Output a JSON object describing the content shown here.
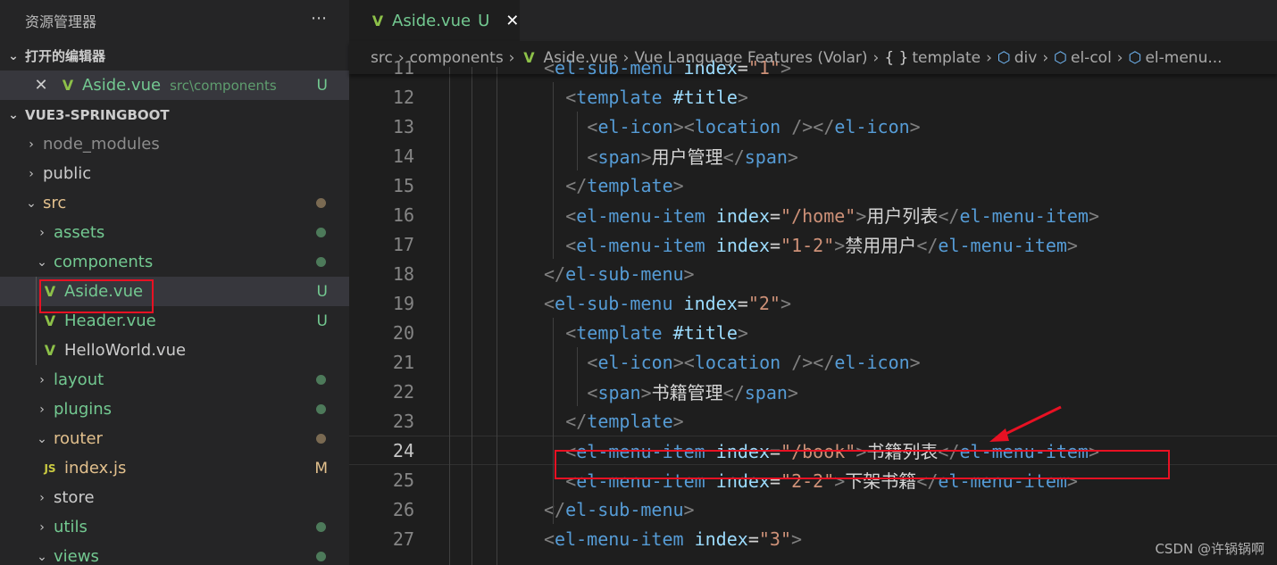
{
  "sidebar": {
    "title": "资源管理器",
    "more_icon": "⋯",
    "open_editors_label": "打开的编辑器",
    "open_editor": {
      "name": "Aside.vue",
      "path": "src\\components",
      "status": "U"
    },
    "project_label": "VUE3-SPRINGBOOT",
    "tree": [
      {
        "name": "node_modules",
        "type": "folder",
        "expanded": false
      },
      {
        "name": "public",
        "type": "folder",
        "expanded": false
      },
      {
        "name": "src",
        "type": "folder",
        "expanded": true
      },
      {
        "name": "assets",
        "type": "folder",
        "expanded": false
      },
      {
        "name": "components",
        "type": "folder",
        "expanded": true
      },
      {
        "name": "Aside.vue",
        "type": "vue",
        "status": "U"
      },
      {
        "name": "Header.vue",
        "type": "vue",
        "status": "U"
      },
      {
        "name": "HelloWorld.vue",
        "type": "vue"
      },
      {
        "name": "layout",
        "type": "folder",
        "expanded": false
      },
      {
        "name": "plugins",
        "type": "folder",
        "expanded": false
      },
      {
        "name": "router",
        "type": "folder",
        "expanded": true
      },
      {
        "name": "index.js",
        "type": "js",
        "status": "M"
      },
      {
        "name": "store",
        "type": "folder",
        "expanded": false
      },
      {
        "name": "utils",
        "type": "folder",
        "expanded": false
      },
      {
        "name": "views",
        "type": "folder",
        "expanded": true
      }
    ]
  },
  "editor": {
    "tab": {
      "name": "Aside.vue",
      "status": "U",
      "close": "✕"
    },
    "breadcrumb": [
      "src",
      "components",
      "Aside.vue",
      "Vue Language Features (Volar)",
      "template",
      "div",
      "el-col",
      "el-menu..."
    ],
    "lines": [
      {
        "n": "11",
        "indent": 0,
        "tokens": [
          [
            "br",
            "<"
          ],
          [
            "tag",
            "el-sub-menu"
          ],
          [
            "plain",
            " "
          ],
          [
            "attr",
            "index"
          ],
          [
            "plain",
            "="
          ],
          [
            "str",
            "\"1\""
          ],
          [
            "br",
            ">"
          ]
        ]
      },
      {
        "n": "12",
        "indent": 1,
        "tokens": [
          [
            "br",
            "<"
          ],
          [
            "tag",
            "template"
          ],
          [
            "plain",
            " "
          ],
          [
            "attr",
            "#title"
          ],
          [
            "br",
            ">"
          ]
        ]
      },
      {
        "n": "13",
        "indent": 2,
        "tokens": [
          [
            "br",
            "<"
          ],
          [
            "tag",
            "el-icon"
          ],
          [
            "br",
            "><"
          ],
          [
            "tag",
            "location"
          ],
          [
            "plain",
            " "
          ],
          [
            "br",
            "/></"
          ],
          [
            "tag",
            "el-icon"
          ],
          [
            "br",
            ">"
          ]
        ]
      },
      {
        "n": "14",
        "indent": 2,
        "tokens": [
          [
            "br",
            "<"
          ],
          [
            "tag",
            "span"
          ],
          [
            "br",
            ">"
          ],
          [
            "plain",
            "用户管理"
          ],
          [
            "br",
            "</"
          ],
          [
            "tag",
            "span"
          ],
          [
            "br",
            ">"
          ]
        ]
      },
      {
        "n": "15",
        "indent": 1,
        "tokens": [
          [
            "br",
            "</"
          ],
          [
            "tag",
            "template"
          ],
          [
            "br",
            ">"
          ]
        ]
      },
      {
        "n": "16",
        "indent": 1,
        "tokens": [
          [
            "br",
            "<"
          ],
          [
            "tag",
            "el-menu-item"
          ],
          [
            "plain",
            " "
          ],
          [
            "attr",
            "index"
          ],
          [
            "plain",
            "="
          ],
          [
            "str",
            "\"/home\""
          ],
          [
            "br",
            ">"
          ],
          [
            "plain",
            "用户列表"
          ],
          [
            "br",
            "</"
          ],
          [
            "tag",
            "el-menu-item"
          ],
          [
            "br",
            ">"
          ]
        ]
      },
      {
        "n": "17",
        "indent": 1,
        "tokens": [
          [
            "br",
            "<"
          ],
          [
            "tag",
            "el-menu-item"
          ],
          [
            "plain",
            " "
          ],
          [
            "attr",
            "index"
          ],
          [
            "plain",
            "="
          ],
          [
            "str",
            "\"1-2\""
          ],
          [
            "br",
            ">"
          ],
          [
            "plain",
            "禁用用户"
          ],
          [
            "br",
            "</"
          ],
          [
            "tag",
            "el-menu-item"
          ],
          [
            "br",
            ">"
          ]
        ]
      },
      {
        "n": "18",
        "indent": 0,
        "tokens": [
          [
            "br",
            "</"
          ],
          [
            "tag",
            "el-sub-menu"
          ],
          [
            "br",
            ">"
          ]
        ]
      },
      {
        "n": "19",
        "indent": 0,
        "tokens": [
          [
            "br",
            "<"
          ],
          [
            "tag",
            "el-sub-menu"
          ],
          [
            "plain",
            " "
          ],
          [
            "attr",
            "index"
          ],
          [
            "plain",
            "="
          ],
          [
            "str",
            "\"2\""
          ],
          [
            "br",
            ">"
          ]
        ]
      },
      {
        "n": "20",
        "indent": 1,
        "tokens": [
          [
            "br",
            "<"
          ],
          [
            "tag",
            "template"
          ],
          [
            "plain",
            " "
          ],
          [
            "attr",
            "#title"
          ],
          [
            "br",
            ">"
          ]
        ]
      },
      {
        "n": "21",
        "indent": 2,
        "tokens": [
          [
            "br",
            "<"
          ],
          [
            "tag",
            "el-icon"
          ],
          [
            "br",
            "><"
          ],
          [
            "tag",
            "location"
          ],
          [
            "plain",
            " "
          ],
          [
            "br",
            "/></"
          ],
          [
            "tag",
            "el-icon"
          ],
          [
            "br",
            ">"
          ]
        ]
      },
      {
        "n": "22",
        "indent": 2,
        "tokens": [
          [
            "br",
            "<"
          ],
          [
            "tag",
            "span"
          ],
          [
            "br",
            ">"
          ],
          [
            "plain",
            "书籍管理"
          ],
          [
            "br",
            "</"
          ],
          [
            "tag",
            "span"
          ],
          [
            "br",
            ">"
          ]
        ]
      },
      {
        "n": "23",
        "indent": 1,
        "tokens": [
          [
            "br",
            "</"
          ],
          [
            "tag",
            "template"
          ],
          [
            "br",
            ">"
          ]
        ]
      },
      {
        "n": "24",
        "indent": 1,
        "current": true,
        "tokens": [
          [
            "br",
            "<"
          ],
          [
            "tag",
            "el-menu-item"
          ],
          [
            "plain",
            " "
          ],
          [
            "attr",
            "index"
          ],
          [
            "plain",
            "="
          ],
          [
            "str",
            "\"/book\""
          ],
          [
            "br",
            ">"
          ],
          [
            "plain",
            "书籍列表"
          ],
          [
            "br",
            "</"
          ],
          [
            "tag",
            "el-menu-item"
          ],
          [
            "br",
            ">"
          ]
        ]
      },
      {
        "n": "25",
        "indent": 1,
        "tokens": [
          [
            "br",
            "<"
          ],
          [
            "tag",
            "el-menu-item"
          ],
          [
            "plain",
            " "
          ],
          [
            "attr",
            "index"
          ],
          [
            "plain",
            "="
          ],
          [
            "str",
            "\"2-2\""
          ],
          [
            "br",
            ">"
          ],
          [
            "plain",
            "下架书籍"
          ],
          [
            "br",
            "</"
          ],
          [
            "tag",
            "el-menu-item"
          ],
          [
            "br",
            ">"
          ]
        ]
      },
      {
        "n": "26",
        "indent": 0,
        "tokens": [
          [
            "br",
            "</"
          ],
          [
            "tag",
            "el-sub-menu"
          ],
          [
            "br",
            ">"
          ]
        ]
      },
      {
        "n": "27",
        "indent": 0,
        "tokens": [
          [
            "br",
            "<"
          ],
          [
            "tag",
            "el-menu-item"
          ],
          [
            "plain",
            " "
          ],
          [
            "attr",
            "index"
          ],
          [
            "plain",
            "="
          ],
          [
            "str",
            "\"3\""
          ],
          [
            "br",
            ">"
          ]
        ]
      }
    ]
  },
  "watermark": "CSDN @许锅锅啊",
  "colors": {
    "accent_green": "#73c991",
    "highlight_red": "#e81123",
    "vue_icon": "#8dc149"
  }
}
